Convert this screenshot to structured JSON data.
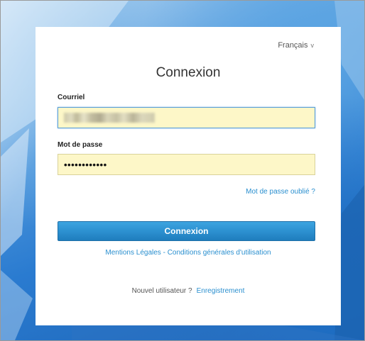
{
  "language_selector": {
    "label": "Français",
    "chevron": "v"
  },
  "login": {
    "title": "Connexion",
    "email": {
      "label": "Courriel",
      "value": ""
    },
    "password": {
      "label": "Mot de passe",
      "value": "••••••••••••"
    },
    "forgot_password": "Mot de passe oublié ?",
    "submit_label": "Connexion"
  },
  "footer": {
    "legal_notices": "Mentions Légales",
    "separator": " - ",
    "terms": "Conditions générales d'utilisation",
    "new_user_text": "Nouvel utilisateur ?",
    "register_link": "Enregistrement"
  },
  "colors": {
    "accent": "#2a8fcf",
    "button": "#2b8fcf",
    "input_background": "#fdf7c8",
    "background": "#2a7bd0"
  }
}
